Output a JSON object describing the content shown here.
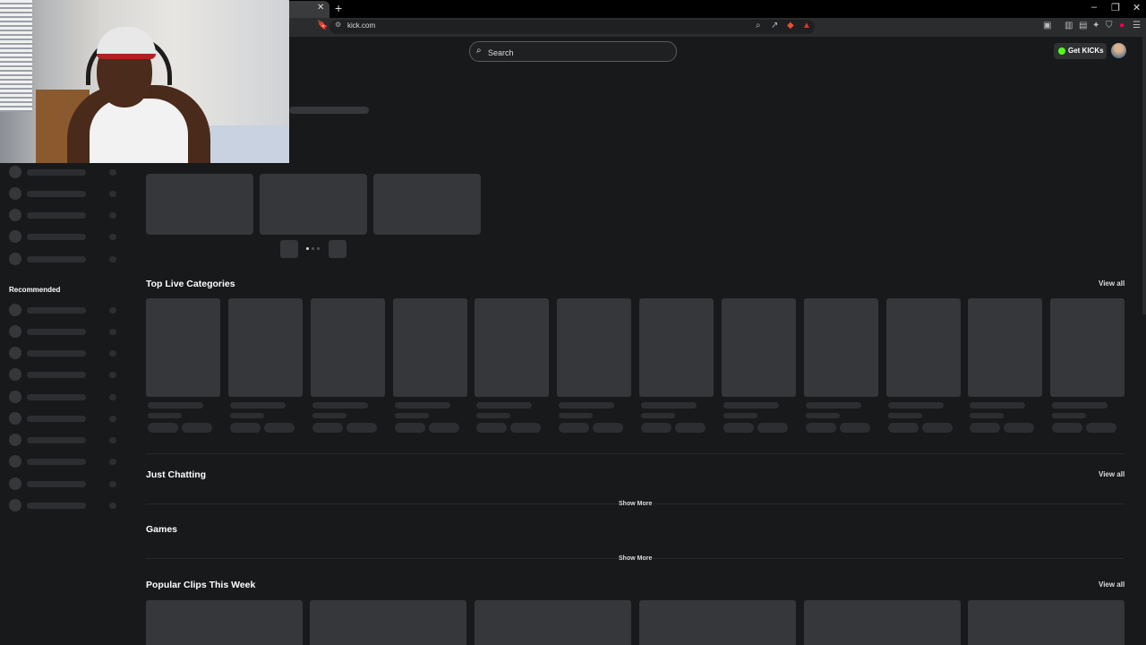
{
  "browser": {
    "url": "kick.com",
    "tab_close": "✕",
    "new_tab": "+",
    "controls": [
      "–",
      "❐",
      "✕"
    ]
  },
  "header": {
    "search_placeholder": "Search",
    "get_kicks_label": "Get KICKs"
  },
  "sidebar": {
    "recommended_label": "Recommended"
  },
  "sections": {
    "top_live_categories": {
      "title": "Top Live Categories",
      "view_all": "View all"
    },
    "just_chatting": {
      "title": "Just Chatting",
      "view_all": "View all",
      "show_more": "Show More"
    },
    "games": {
      "title": "Games",
      "show_more": "Show More"
    },
    "popular_clips": {
      "title": "Popular Clips This Week",
      "view_all": "View all"
    }
  },
  "colors": {
    "background": "#18191b",
    "skeleton": "#35373a",
    "accent": "#53fc18"
  }
}
